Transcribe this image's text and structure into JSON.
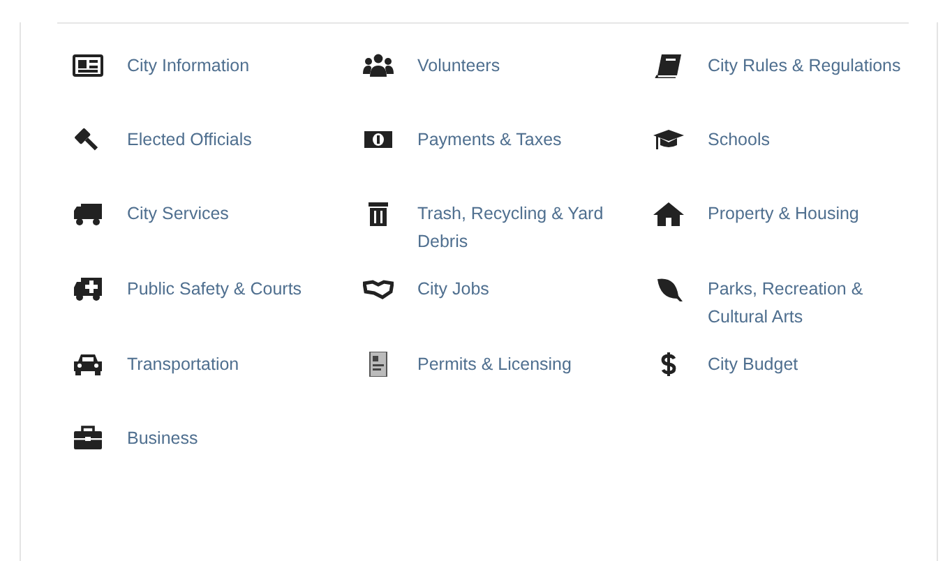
{
  "categories": [
    {
      "label": "City Information"
    },
    {
      "label": "Volunteers"
    },
    {
      "label": "City Rules & Regulations"
    },
    {
      "label": "Elected Officials"
    },
    {
      "label": "Payments & Taxes"
    },
    {
      "label": "Schools"
    },
    {
      "label": "City Services"
    },
    {
      "label": "Trash, Recycling & Yard Debris"
    },
    {
      "label": "Property & Housing"
    },
    {
      "label": "Public Safety & Courts"
    },
    {
      "label": "City Jobs"
    },
    {
      "label": "Parks, Recreation & Cultural Arts"
    },
    {
      "label": "Transportation"
    },
    {
      "label": "Permits & Licensing"
    },
    {
      "label": "City Budget"
    },
    {
      "label": "Business"
    }
  ]
}
